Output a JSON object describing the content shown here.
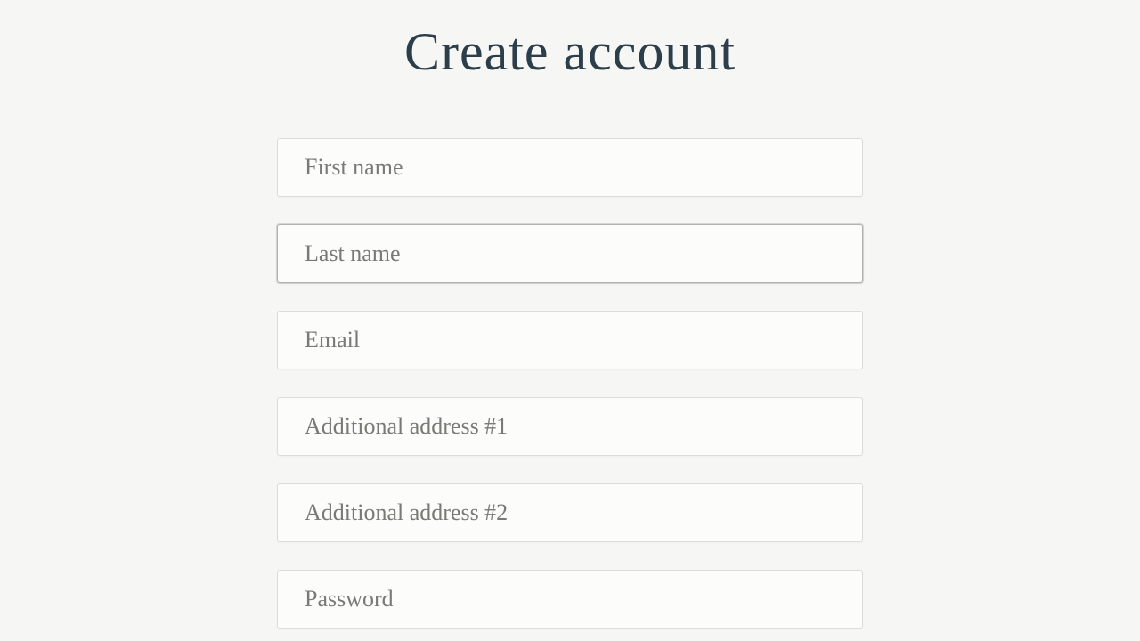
{
  "header": {
    "title": "Create account"
  },
  "form": {
    "first_name": {
      "placeholder": "First name",
      "value": ""
    },
    "last_name": {
      "placeholder": "Last name",
      "value": ""
    },
    "email": {
      "placeholder": "Email",
      "value": ""
    },
    "address1": {
      "placeholder": "Additional address #1",
      "value": ""
    },
    "address2": {
      "placeholder": "Additional address #2",
      "value": ""
    },
    "password": {
      "placeholder": "Password",
      "value": ""
    }
  }
}
